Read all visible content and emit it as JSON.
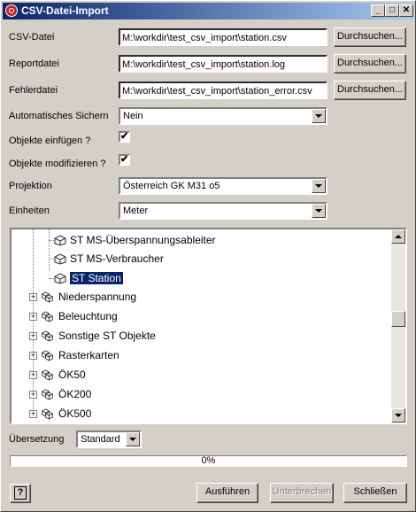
{
  "window": {
    "title": "CSV-Datei-Import",
    "min": "_",
    "max": "□",
    "close": "✕"
  },
  "files": {
    "csv_label": "CSV-Datei",
    "csv_value": "M:\\workdir\\test_csv_import\\station.csv",
    "report_label": "Reportdatei",
    "report_value": "M:\\workdir\\test_csv_import\\station.log",
    "error_label": "Fehlerdatei",
    "error_value": "M:\\workdir\\test_csv_import\\station_error.csv",
    "browse_label": "Durchsuchen..."
  },
  "options": {
    "autosave_label": "Automatisches Sichern",
    "autosave_value": "Nein",
    "insert_label": "Objekte einfügen ?",
    "insert_checked": "✔",
    "modify_label": "Objekte modifizieren ?",
    "modify_checked": "✔",
    "projection_label": "Projektion",
    "projection_value": "Österreich GK M31 o5",
    "units_label": "Einheiten",
    "units_value": "Meter"
  },
  "tree": {
    "children": [
      "ST MS-Überspannungsableiter",
      "ST MS-Verbraucher",
      "ST Station"
    ],
    "groups": [
      "Niederspannung",
      "Beleuchtung",
      "Sonstige ST Objekte",
      "Rasterkarten",
      "ÖK50",
      "ÖK200",
      "ÖK500"
    ]
  },
  "translation": {
    "label": "Übersetzung",
    "value": "Standard"
  },
  "progress": {
    "value": 0,
    "text": "0%"
  },
  "footer": {
    "help": "?",
    "run": "Ausführen",
    "interrupt": "Unterbrechen",
    "close": "Schließen"
  }
}
